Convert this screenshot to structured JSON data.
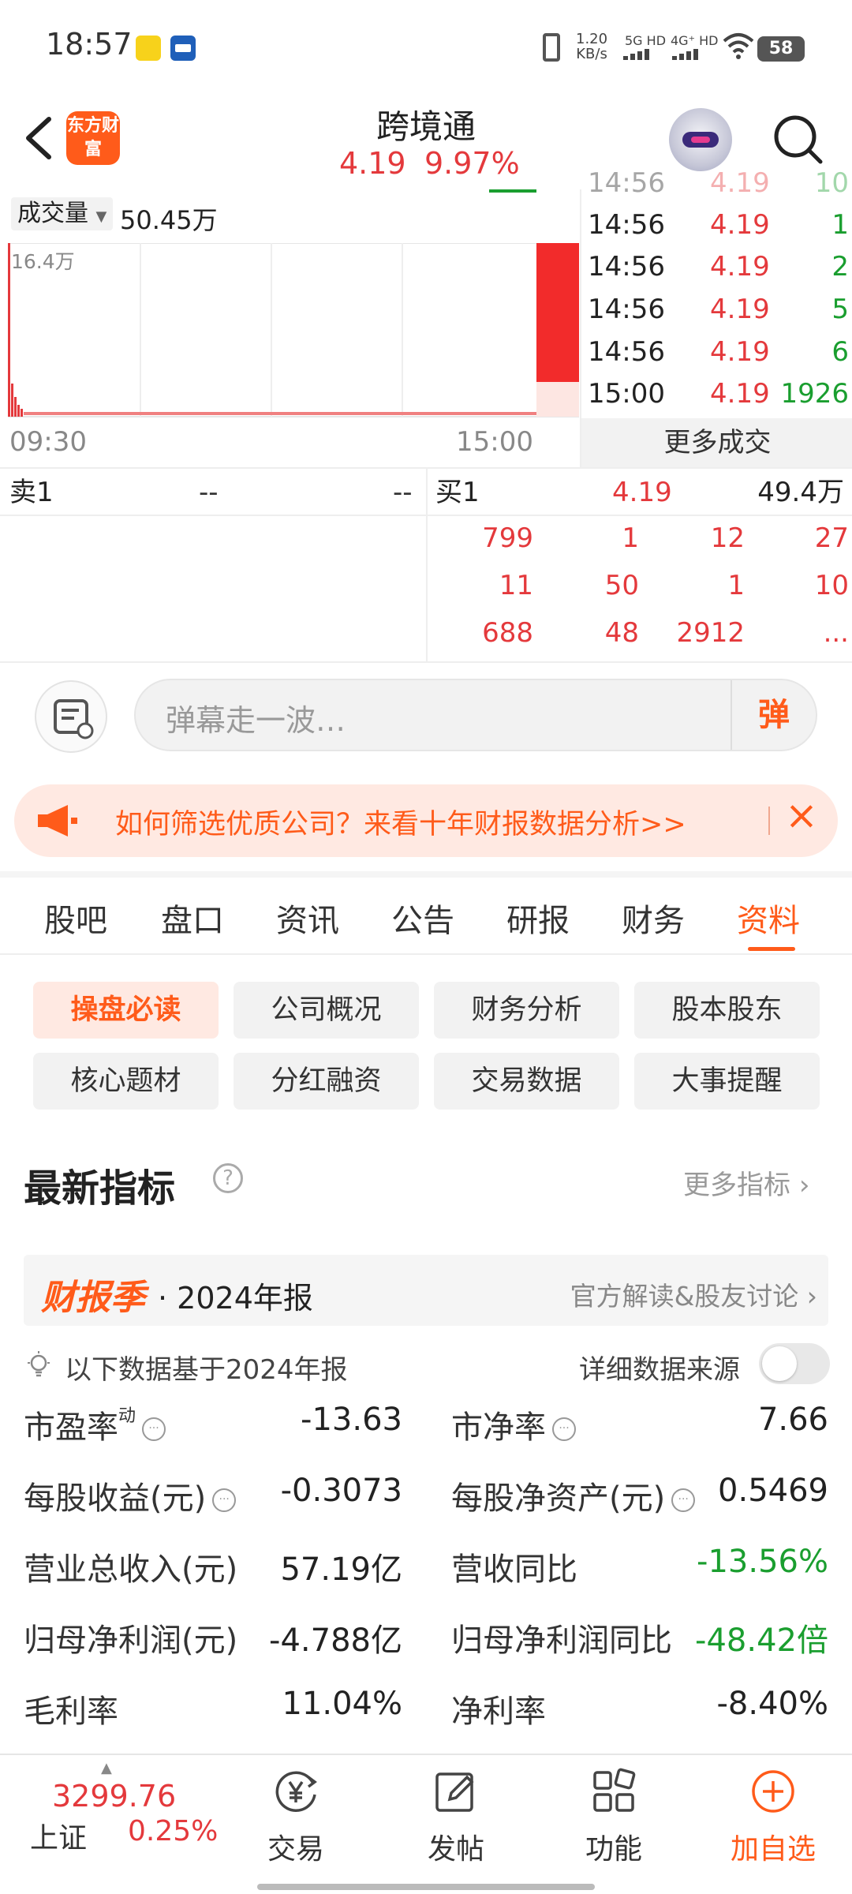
{
  "status_bar": {
    "time": "18:57",
    "net_speed": "1.20",
    "net_unit": "KB/s",
    "sim1": "5G HD",
    "sim2": "4G⁺ HD",
    "battery": "58"
  },
  "header": {
    "logo_text": "东方财富",
    "stock_name": "跨境通",
    "price": "4.19",
    "change_pct": "9.97%"
  },
  "volume_chart": {
    "label": "成交量",
    "value": "50.45万",
    "max_label": "16.4万",
    "time_start": "09:30",
    "time_end": "15:00"
  },
  "trades": {
    "rows": [
      {
        "time": "14:56",
        "price": "4.19",
        "vol": "1"
      },
      {
        "time": "14:56",
        "price": "4.19",
        "vol": "2"
      },
      {
        "time": "14:56",
        "price": "4.19",
        "vol": "5"
      },
      {
        "time": "14:56",
        "price": "4.19",
        "vol": "6"
      },
      {
        "time": "15:00",
        "price": "4.19",
        "vol": "1926"
      }
    ],
    "more_label": "更多成交"
  },
  "orderbook": {
    "sell1_label": "卖1",
    "sell1_price": "--",
    "sell1_vol": "--",
    "buy1_label": "买1",
    "buy1_price": "4.19",
    "buy1_vol": "49.4万",
    "queue": [
      [
        "799",
        "1",
        "12",
        "27"
      ],
      [
        "11",
        "50",
        "1",
        "10"
      ],
      [
        "688",
        "48",
        "2912",
        "..."
      ]
    ]
  },
  "barrage": {
    "placeholder": "弹幕走一波…",
    "send_label": "弹"
  },
  "promo": {
    "text": "如何筛选优质公司？来看十年财报数据分析>>"
  },
  "tabs": [
    "股吧",
    "盘口",
    "资讯",
    "公告",
    "研报",
    "财务",
    "资料"
  ],
  "sub_buttons": [
    "操盘必读",
    "公司概况",
    "财务分析",
    "股本股东",
    "核心题材",
    "分红融资",
    "交易数据",
    "大事提醒"
  ],
  "indicators": {
    "title": "最新指标",
    "more": "更多指标",
    "report_tag": "财报季",
    "report_year": "· 2024年报",
    "report_link": "官方解读&股友讨论",
    "note": "以下数据基于2024年报",
    "source_label": "详细数据来源",
    "metrics": [
      {
        "l1": "市盈率",
        "l1_sup": "动",
        "v1": "-13.63",
        "l2": "市净率",
        "v2": "7.66"
      },
      {
        "l1": "每股收益(元)",
        "v1": "-0.3073",
        "l2": "每股净资产(元)",
        "v2": "0.5469"
      },
      {
        "l1": "营业总收入(元)",
        "v1": "57.19亿",
        "l2": "营收同比",
        "v2": "-13.56%"
      },
      {
        "l1": "归母净利润(元)",
        "v1": "-4.788亿",
        "l2": "归母净利润同比",
        "v2": "-48.42倍"
      },
      {
        "l1": "毛利率",
        "v1": "11.04%",
        "l2": "净利率",
        "v2": "-8.40%"
      }
    ]
  },
  "bottom_nav": {
    "index_value": "3299.76",
    "index_name": "上证",
    "index_pct": "0.25%",
    "items": [
      "交易",
      "发帖",
      "功能",
      "加自选"
    ]
  },
  "colors": {
    "accent": "#ff5b1a",
    "up": "#e4393c",
    "down": "#1a9e2f"
  }
}
